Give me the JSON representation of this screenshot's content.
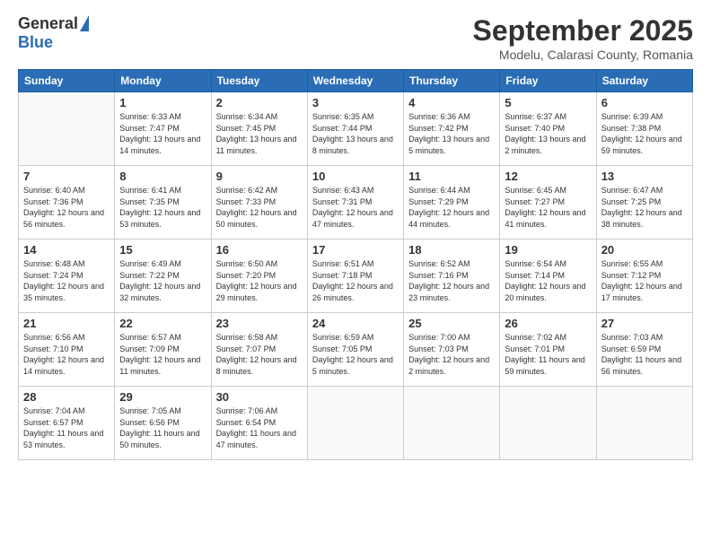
{
  "logo": {
    "general": "General",
    "blue": "Blue"
  },
  "title": "September 2025",
  "location": "Modelu, Calarasi County, Romania",
  "headers": [
    "Sunday",
    "Monday",
    "Tuesday",
    "Wednesday",
    "Thursday",
    "Friday",
    "Saturday"
  ],
  "weeks": [
    [
      {
        "day": "",
        "sunrise": "",
        "sunset": "",
        "daylight": ""
      },
      {
        "day": "1",
        "sunrise": "Sunrise: 6:33 AM",
        "sunset": "Sunset: 7:47 PM",
        "daylight": "Daylight: 13 hours and 14 minutes."
      },
      {
        "day": "2",
        "sunrise": "Sunrise: 6:34 AM",
        "sunset": "Sunset: 7:45 PM",
        "daylight": "Daylight: 13 hours and 11 minutes."
      },
      {
        "day": "3",
        "sunrise": "Sunrise: 6:35 AM",
        "sunset": "Sunset: 7:44 PM",
        "daylight": "Daylight: 13 hours and 8 minutes."
      },
      {
        "day": "4",
        "sunrise": "Sunrise: 6:36 AM",
        "sunset": "Sunset: 7:42 PM",
        "daylight": "Daylight: 13 hours and 5 minutes."
      },
      {
        "day": "5",
        "sunrise": "Sunrise: 6:37 AM",
        "sunset": "Sunset: 7:40 PM",
        "daylight": "Daylight: 13 hours and 2 minutes."
      },
      {
        "day": "6",
        "sunrise": "Sunrise: 6:39 AM",
        "sunset": "Sunset: 7:38 PM",
        "daylight": "Daylight: 12 hours and 59 minutes."
      }
    ],
    [
      {
        "day": "7",
        "sunrise": "Sunrise: 6:40 AM",
        "sunset": "Sunset: 7:36 PM",
        "daylight": "Daylight: 12 hours and 56 minutes."
      },
      {
        "day": "8",
        "sunrise": "Sunrise: 6:41 AM",
        "sunset": "Sunset: 7:35 PM",
        "daylight": "Daylight: 12 hours and 53 minutes."
      },
      {
        "day": "9",
        "sunrise": "Sunrise: 6:42 AM",
        "sunset": "Sunset: 7:33 PM",
        "daylight": "Daylight: 12 hours and 50 minutes."
      },
      {
        "day": "10",
        "sunrise": "Sunrise: 6:43 AM",
        "sunset": "Sunset: 7:31 PM",
        "daylight": "Daylight: 12 hours and 47 minutes."
      },
      {
        "day": "11",
        "sunrise": "Sunrise: 6:44 AM",
        "sunset": "Sunset: 7:29 PM",
        "daylight": "Daylight: 12 hours and 44 minutes."
      },
      {
        "day": "12",
        "sunrise": "Sunrise: 6:45 AM",
        "sunset": "Sunset: 7:27 PM",
        "daylight": "Daylight: 12 hours and 41 minutes."
      },
      {
        "day": "13",
        "sunrise": "Sunrise: 6:47 AM",
        "sunset": "Sunset: 7:25 PM",
        "daylight": "Daylight: 12 hours and 38 minutes."
      }
    ],
    [
      {
        "day": "14",
        "sunrise": "Sunrise: 6:48 AM",
        "sunset": "Sunset: 7:24 PM",
        "daylight": "Daylight: 12 hours and 35 minutes."
      },
      {
        "day": "15",
        "sunrise": "Sunrise: 6:49 AM",
        "sunset": "Sunset: 7:22 PM",
        "daylight": "Daylight: 12 hours and 32 minutes."
      },
      {
        "day": "16",
        "sunrise": "Sunrise: 6:50 AM",
        "sunset": "Sunset: 7:20 PM",
        "daylight": "Daylight: 12 hours and 29 minutes."
      },
      {
        "day": "17",
        "sunrise": "Sunrise: 6:51 AM",
        "sunset": "Sunset: 7:18 PM",
        "daylight": "Daylight: 12 hours and 26 minutes."
      },
      {
        "day": "18",
        "sunrise": "Sunrise: 6:52 AM",
        "sunset": "Sunset: 7:16 PM",
        "daylight": "Daylight: 12 hours and 23 minutes."
      },
      {
        "day": "19",
        "sunrise": "Sunrise: 6:54 AM",
        "sunset": "Sunset: 7:14 PM",
        "daylight": "Daylight: 12 hours and 20 minutes."
      },
      {
        "day": "20",
        "sunrise": "Sunrise: 6:55 AM",
        "sunset": "Sunset: 7:12 PM",
        "daylight": "Daylight: 12 hours and 17 minutes."
      }
    ],
    [
      {
        "day": "21",
        "sunrise": "Sunrise: 6:56 AM",
        "sunset": "Sunset: 7:10 PM",
        "daylight": "Daylight: 12 hours and 14 minutes."
      },
      {
        "day": "22",
        "sunrise": "Sunrise: 6:57 AM",
        "sunset": "Sunset: 7:09 PM",
        "daylight": "Daylight: 12 hours and 11 minutes."
      },
      {
        "day": "23",
        "sunrise": "Sunrise: 6:58 AM",
        "sunset": "Sunset: 7:07 PM",
        "daylight": "Daylight: 12 hours and 8 minutes."
      },
      {
        "day": "24",
        "sunrise": "Sunrise: 6:59 AM",
        "sunset": "Sunset: 7:05 PM",
        "daylight": "Daylight: 12 hours and 5 minutes."
      },
      {
        "day": "25",
        "sunrise": "Sunrise: 7:00 AM",
        "sunset": "Sunset: 7:03 PM",
        "daylight": "Daylight: 12 hours and 2 minutes."
      },
      {
        "day": "26",
        "sunrise": "Sunrise: 7:02 AM",
        "sunset": "Sunset: 7:01 PM",
        "daylight": "Daylight: 11 hours and 59 minutes."
      },
      {
        "day": "27",
        "sunrise": "Sunrise: 7:03 AM",
        "sunset": "Sunset: 6:59 PM",
        "daylight": "Daylight: 11 hours and 56 minutes."
      }
    ],
    [
      {
        "day": "28",
        "sunrise": "Sunrise: 7:04 AM",
        "sunset": "Sunset: 6:57 PM",
        "daylight": "Daylight: 11 hours and 53 minutes."
      },
      {
        "day": "29",
        "sunrise": "Sunrise: 7:05 AM",
        "sunset": "Sunset: 6:56 PM",
        "daylight": "Daylight: 11 hours and 50 minutes."
      },
      {
        "day": "30",
        "sunrise": "Sunrise: 7:06 AM",
        "sunset": "Sunset: 6:54 PM",
        "daylight": "Daylight: 11 hours and 47 minutes."
      },
      {
        "day": "",
        "sunrise": "",
        "sunset": "",
        "daylight": ""
      },
      {
        "day": "",
        "sunrise": "",
        "sunset": "",
        "daylight": ""
      },
      {
        "day": "",
        "sunrise": "",
        "sunset": "",
        "daylight": ""
      },
      {
        "day": "",
        "sunrise": "",
        "sunset": "",
        "daylight": ""
      }
    ]
  ]
}
